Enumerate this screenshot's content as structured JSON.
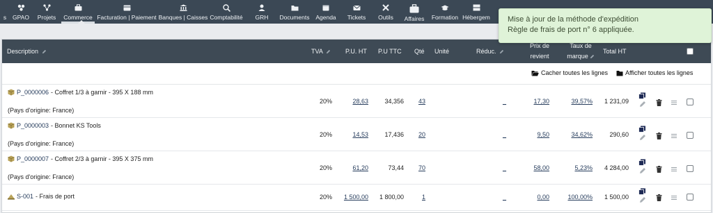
{
  "nav": {
    "items": [
      {
        "label": "s",
        "icon": "none"
      },
      {
        "label": "GPAO",
        "icon": "gpao-icon"
      },
      {
        "label": "Projets",
        "icon": "projects-icon"
      },
      {
        "label": "Commerce",
        "icon": "briefcase-icon"
      },
      {
        "label": "Facturation | Paiement",
        "icon": "invoice-icon"
      },
      {
        "label": "Banques | Caisses",
        "icon": "bank-icon"
      },
      {
        "label": "Comptabilité",
        "icon": "search-dollar-icon"
      },
      {
        "label": "GRH",
        "icon": "user-icon"
      },
      {
        "label": "Documents",
        "icon": "folder-icon"
      },
      {
        "label": "Agenda",
        "icon": "calendar-icon"
      },
      {
        "label": "Tickets",
        "icon": "ticket-icon"
      },
      {
        "label": "Outils",
        "icon": "tools-icon"
      },
      {
        "label": "Affaires",
        "icon": "briefcase-large-icon"
      },
      {
        "label": "Formation",
        "icon": "graduation-cap-icon"
      },
      {
        "label": "Hébergem",
        "icon": "server-icon"
      }
    ],
    "active": "Commerce"
  },
  "notice": {
    "line1": "Mise à jour de la méthode d'expédition",
    "line2": "Règle de frais de port n° 6 appliquée."
  },
  "table": {
    "headers": {
      "description": "Description",
      "tva": "TVA",
      "pu_ht": "P.U. HT",
      "pu_ttc": "P.U TTC",
      "qte": "Qté",
      "unite": "Unité",
      "reduc": "Réduc.",
      "prix_revient_1": "Prix de",
      "prix_revient_2": "revient",
      "taux_marque_1": "Taux de",
      "taux_marque_2": "marque",
      "total_ht": "Total HT"
    },
    "toolbar": {
      "hide_all": "Cacher toutes les lignes",
      "show_all": "Afficher toutes les lignes"
    },
    "rows": [
      {
        "ref": "P_0000006",
        "label": " - Coffret 1/3 à garnir - 395 X 188 mm",
        "origin": "(Pays d'origine: France)",
        "tva": "20%",
        "pu_ht": "28,63",
        "pu_ttc": "34,356",
        "qte": "43",
        "reduc": "_",
        "prix_revient": "17,30",
        "taux_marque": "39,57%",
        "total_ht": "1 231,09",
        "icon": "product-box-icon"
      },
      {
        "ref": "P_0000003",
        "label": " - Bonnet KS Tools",
        "origin": "(Pays d'origine: France)",
        "tva": "20%",
        "pu_ht": "14,53",
        "pu_ttc": "17,436",
        "qte": "20",
        "reduc": "_",
        "prix_revient": "9,50",
        "taux_marque": "34,62%",
        "total_ht": "290,60",
        "icon": "product-box-icon"
      },
      {
        "ref": "P_0000007",
        "label": " - Coffret 2/3 à garnir - 395 X 375 mm",
        "origin": "(Pays d'origine: France)",
        "tva": "20%",
        "pu_ht": "61,20",
        "pu_ttc": "73,44",
        "qte": "70",
        "reduc": "_",
        "prix_revient": "58,00",
        "taux_marque": "5,23%",
        "total_ht": "4 284,00",
        "icon": "product-box-icon"
      },
      {
        "ref": "S-001",
        "label": " - Frais de port",
        "origin": "",
        "tva": "20%",
        "pu_ht": "1 500,00",
        "pu_ttc": "1 800,00",
        "qte": "1",
        "reduc": "_",
        "prix_revient": "0,00",
        "taux_marque": "100,00%",
        "total_ht": "1 500,00",
        "icon": "service-icon"
      }
    ]
  },
  "colors": {
    "topbar": "#3b4855",
    "table_header": "#3e4a55",
    "link": "#263c5c",
    "notice_bg": "#dff3d8",
    "product_icon": "#b9a35a"
  }
}
